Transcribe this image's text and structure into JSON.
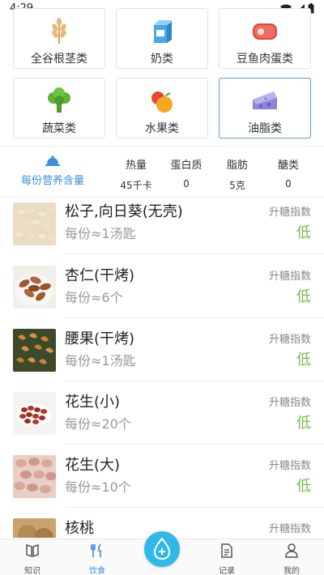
{
  "status_bar": {
    "time": "4:29"
  },
  "categories": [
    {
      "label": "全谷根茎类",
      "icon": "wheat-icon"
    },
    {
      "label": "奶类",
      "icon": "milk-carton-icon"
    },
    {
      "label": "豆鱼肉蛋类",
      "icon": "meat-icon"
    },
    {
      "label": "蔬菜类",
      "icon": "broccoli-icon"
    },
    {
      "label": "水果类",
      "icon": "fruit-icon"
    },
    {
      "label": "油脂类",
      "icon": "cheese-icon",
      "selected": true
    }
  ],
  "nutrition": {
    "label": "每份营养含量",
    "columns": [
      {
        "name": "热量",
        "value": "45千卡"
      },
      {
        "name": "蛋白质",
        "value": "0"
      },
      {
        "name": "脂肪",
        "value": "5克"
      },
      {
        "name": "醣类",
        "value": "0"
      }
    ]
  },
  "foods": [
    {
      "name": "松子,向日葵(无壳)",
      "portion": "每份≈1汤匙",
      "gi_label": "升糖指数",
      "gi_value": "低"
    },
    {
      "name": "杏仁(干烤)",
      "portion": "每份≈6个",
      "gi_label": "升糖指数",
      "gi_value": "低"
    },
    {
      "name": "腰果(干烤)",
      "portion": "每份≈1汤匙",
      "gi_label": "升糖指数",
      "gi_value": "低"
    },
    {
      "name": "花生(小)",
      "portion": "每份≈20个",
      "gi_label": "升糖指数",
      "gi_value": "低"
    },
    {
      "name": "花生(大)",
      "portion": "每份≈10个",
      "gi_label": "升糖指数",
      "gi_value": "低"
    },
    {
      "name": "核桃",
      "portion": "",
      "gi_label": "升糖指数",
      "gi_value": ""
    }
  ],
  "bottom_nav": [
    {
      "label": "知识",
      "icon": "book-icon"
    },
    {
      "label": "饮食",
      "icon": "fork-knife-icon",
      "active": true
    },
    {
      "label": "",
      "icon": "water-drop-plus-icon"
    },
    {
      "label": "记录",
      "icon": "document-icon"
    },
    {
      "label": "我的",
      "icon": "person-icon"
    }
  ],
  "colors": {
    "accent": "#3a8fdc",
    "gi_low": "#6cc04a",
    "fab": "#2fb8e8"
  }
}
